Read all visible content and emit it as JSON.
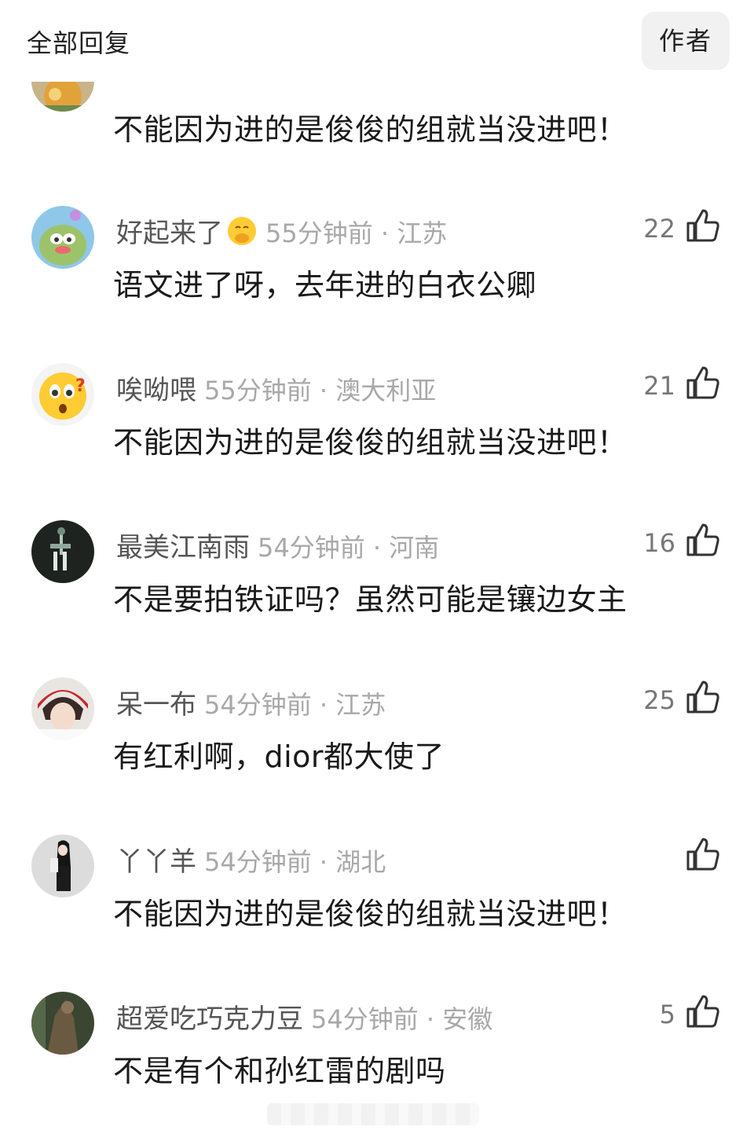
{
  "header": {
    "title": "全部回复",
    "author_button": "作者"
  },
  "partial_comment": {
    "text": "不能因为进的是俊俊的组就当没进吧！"
  },
  "comments": [
    {
      "username": "好起来了",
      "has_emoji": true,
      "time_loc": "55分钟前 · 江苏",
      "likes": "22",
      "text": "语文进了呀，去年进的白衣公卿"
    },
    {
      "username": "唉呦喂",
      "has_emoji": false,
      "time_loc": "55分钟前 · 澳大利亚",
      "likes": "21",
      "text": "不能因为进的是俊俊的组就当没进吧！"
    },
    {
      "username": "最美江南雨",
      "has_emoji": false,
      "time_loc": "54分钟前 · 河南",
      "likes": "16",
      "text": "不是要拍铁证吗？虽然可能是镶边女主"
    },
    {
      "username": "呆一布",
      "has_emoji": false,
      "time_loc": "54分钟前 · 江苏",
      "likes": "25",
      "text": "有红利啊，dior都大使了"
    },
    {
      "username": "丫丫羊",
      "has_emoji": false,
      "time_loc": "54分钟前 · 湖北",
      "likes": "",
      "text": "不能因为进的是俊俊的组就当没进吧！"
    },
    {
      "username": "超爱吃巧克力豆",
      "has_emoji": false,
      "time_loc": "54分钟前 · 安徽",
      "likes": "5",
      "text": "不是有个和孙红雷的剧吗"
    }
  ]
}
